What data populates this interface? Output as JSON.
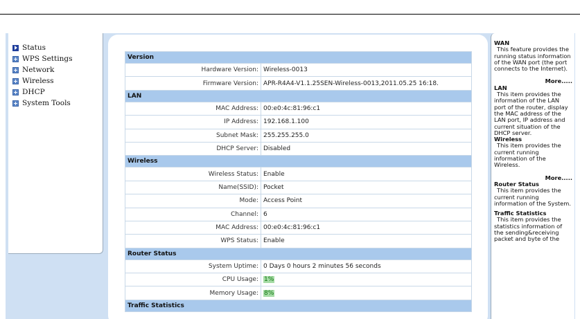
{
  "menu": {
    "items": [
      {
        "label": "Status",
        "icon": "arrow-right-icon"
      },
      {
        "label": "WPS Settings",
        "icon": "plus-box-icon"
      },
      {
        "label": "Network",
        "icon": "plus-box-icon"
      },
      {
        "label": "Wireless",
        "icon": "plus-box-icon"
      },
      {
        "label": "DHCP",
        "icon": "plus-box-icon"
      },
      {
        "label": "System Tools",
        "icon": "plus-box-icon"
      }
    ]
  },
  "status": {
    "version": {
      "title": "Version",
      "hardware_label": "Hardware Version:",
      "hardware_value": "Wireless-0013",
      "firmware_label": "Firmware Version:",
      "firmware_value": "APR-R4A4-V1.1.25SEN-Wireless-0013,2011.05.25 16:18."
    },
    "lan": {
      "title": "LAN",
      "mac_label": "MAC Address:",
      "mac_value": "00:e0:4c:81:96:c1",
      "ip_label": "IP Address:",
      "ip_value": "192.168.1.100",
      "mask_label": "Subnet Mask:",
      "mask_value": "255.255.255.0",
      "dhcp_label": "DHCP Server:",
      "dhcp_value": "Disabled"
    },
    "wireless": {
      "title": "Wireless",
      "status_label": "Wireless Status:",
      "status_value": "Enable",
      "ssid_label": "Name(SSID):",
      "ssid_value": "Pocket",
      "mode_label": "Mode:",
      "mode_value": "Access Point",
      "channel_label": "Channel:",
      "channel_value": "6",
      "mac_label": "MAC Address:",
      "mac_value": "00:e0:4c:81:96:c1",
      "wps_label": "WPS Status:",
      "wps_value": "Enable"
    },
    "router": {
      "title": "Router Status",
      "uptime_label": "System Uptime:",
      "uptime_value": "0 Days 0 hours 2 minutes 56 seconds",
      "cpu_label": "CPU Usage:",
      "cpu_value": "1%",
      "mem_label": "Memory Usage:",
      "mem_value": "8%"
    },
    "traffic": {
      "title": "Traffic Statistics"
    }
  },
  "help": {
    "wan": {
      "title": "WAN",
      "desc": "This feature provides the running status information of the WAN port (the port connects to the Internet).",
      "more": "More....."
    },
    "lan": {
      "title": "LAN",
      "desc": "This item provides the information of the LAN port of the router, display the MAC address of the LAN port, IP address and current situation of the DHCP server."
    },
    "wireless": {
      "title": "Wireless",
      "desc": "This item provides the current running information of the Wireless.",
      "more": "More....."
    },
    "router": {
      "title": "Router Status",
      "desc": "This item provides the current running information of the System."
    },
    "traffic": {
      "title": "Traffic Statistics",
      "desc": "This item provides the statistics information of the sending&receiving packet and byte of the"
    }
  },
  "colors": {
    "frame_bg": "#cfe0f3",
    "section_header": "#a9c9ec",
    "usage_highlight": "#a6dca6",
    "menu_arrow": "#1f3e9c",
    "menu_plus": "#5b86c7"
  }
}
